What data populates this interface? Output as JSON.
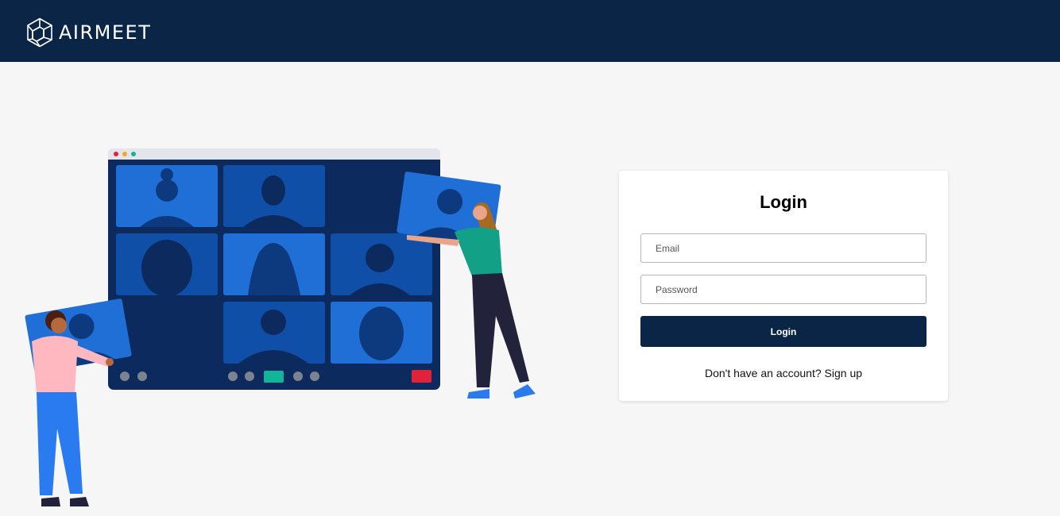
{
  "header": {
    "brand": "AIRMEET"
  },
  "login": {
    "title": "Login",
    "email_placeholder": "Email",
    "password_placeholder": "Password",
    "submit_label": "Login",
    "signup_prompt": "Don't have an account?",
    "signup_link": "Sign up"
  },
  "colors": {
    "navy": "#0b2546",
    "background": "#f6f6f6",
    "tile_blue": "#1f6fd6",
    "accent_green": "#12b59a",
    "end_call_red": "#e0233a"
  },
  "icons": {
    "logo": "airmeet-hexagon-logo"
  }
}
